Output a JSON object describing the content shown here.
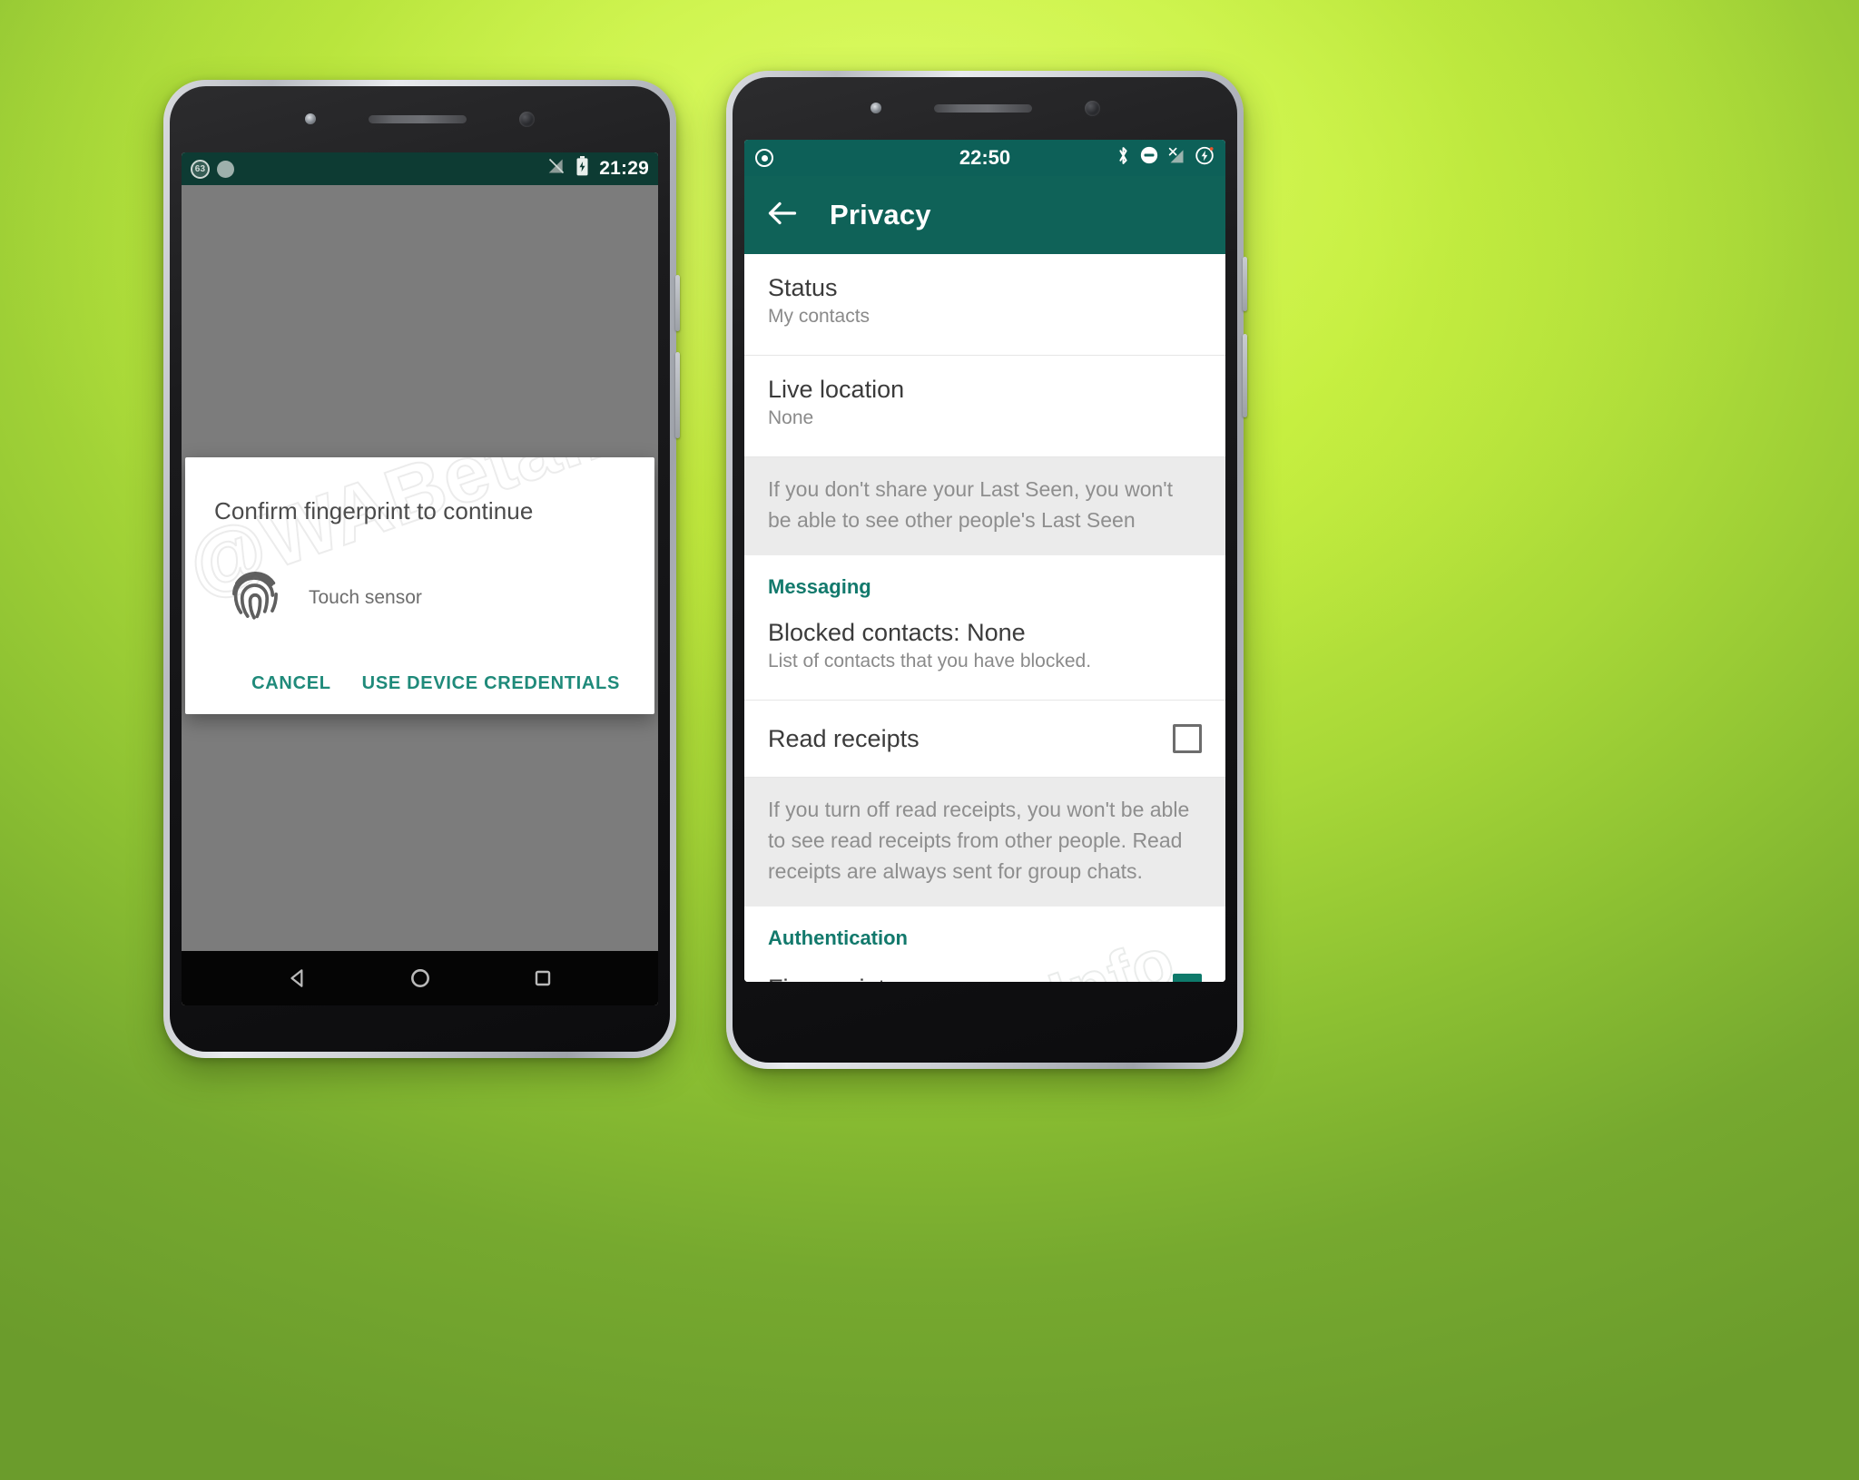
{
  "background": {
    "accent_green": "#c4ed3e",
    "edge_green": "#6b9c2c"
  },
  "watermark": {
    "text": "@WABetaInfo"
  },
  "left_phone": {
    "status_bar": {
      "badge_text": "63",
      "time": "21:29",
      "icons": [
        "notification-circle-icon",
        "notification-dot-icon",
        "signal-off-icon",
        "battery-icon"
      ]
    },
    "dialog": {
      "title": "Confirm fingerprint to continue",
      "subtitle": "Touch sensor",
      "icon": "fingerprint-icon",
      "cancel_label": "CANCEL",
      "credentials_label": "USE DEVICE CREDENTIALS",
      "accent_color": "#1f8a7a"
    },
    "nav_bar": {
      "back": "back-triangle-icon",
      "home": "home-circle-icon",
      "recents": "recents-square-icon"
    }
  },
  "right_phone": {
    "status_bar": {
      "time": "22:50",
      "icons": [
        "screen-record-icon",
        "bluetooth-icon",
        "do-not-disturb-icon",
        "signal-x-icon",
        "battery-charging-icon"
      ]
    },
    "app_bar": {
      "back_icon": "back-arrow-icon",
      "title": "Privacy",
      "bg_color": "#0f6258"
    },
    "settings": [
      {
        "type": "item",
        "title": "Status",
        "subtitle": "My contacts"
      },
      {
        "type": "item",
        "title": "Live location",
        "subtitle": "None"
      },
      {
        "type": "note",
        "text": "If you don't share your Last Seen, you won't be able to see other people's Last Seen"
      },
      {
        "type": "header",
        "title": "Messaging",
        "color": "#12796c"
      },
      {
        "type": "item",
        "title": "Blocked contacts: None",
        "subtitle": "List of contacts that you have blocked."
      },
      {
        "type": "checkbox",
        "title": "Read receipts",
        "checked": false
      },
      {
        "type": "note",
        "text": "If you turn off read receipts, you won't be able to see read receipts from other people. Read receipts are always sent for group chats."
      },
      {
        "type": "header",
        "title": "Authentication",
        "color": "#12796c"
      },
      {
        "type": "checkbox",
        "title": "Fingerprint",
        "checked": true
      }
    ]
  }
}
